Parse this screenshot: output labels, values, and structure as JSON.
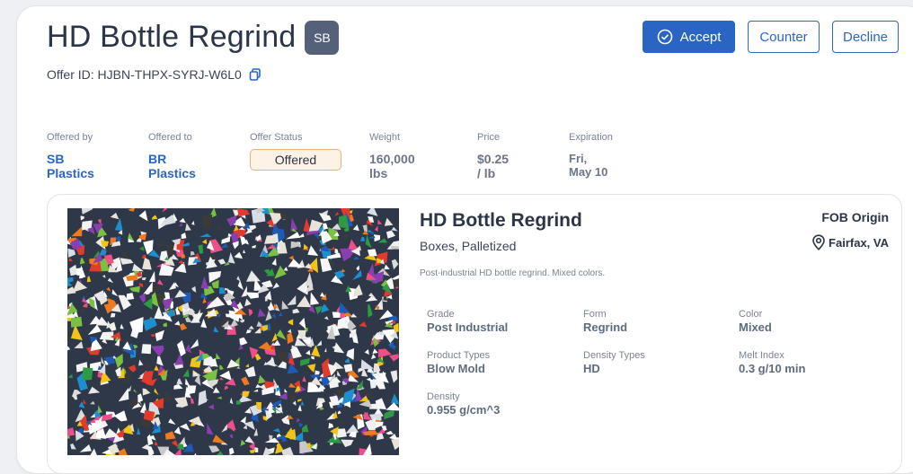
{
  "header": {
    "title": "HD Bottle Regrind",
    "badge": "SB",
    "offer_id_label": "Offer ID:",
    "offer_id": "HJBN-THPX-SYRJ-W6L0"
  },
  "actions": {
    "accept": "Accept",
    "counter": "Counter",
    "decline": "Decline"
  },
  "meta": [
    {
      "label": "Offered by",
      "value": "SB Plastics"
    },
    {
      "label": "Offered to",
      "value": "BR Plastics"
    },
    {
      "label": "Offer Status",
      "value": "Offered"
    },
    {
      "label": "Weight",
      "value": "160,000 lbs"
    },
    {
      "label": "Price",
      "value": "$0.25 / lb"
    },
    {
      "label": "Expiration",
      "value": "Fri, May 10"
    }
  ],
  "listing": {
    "title": "HD Bottle Regrind",
    "packaging": "Boxes, Palletized",
    "description": "Post-industrial HD bottle regrind. Mixed colors.",
    "fob": "FOB Origin",
    "location": "Fairfax, VA",
    "specs": [
      {
        "label": "Grade",
        "value": "Post Industrial"
      },
      {
        "label": "Form",
        "value": "Regrind"
      },
      {
        "label": "Color",
        "value": "Mixed"
      },
      {
        "label": "Product Types",
        "value": "Blow Mold"
      },
      {
        "label": "Density Types",
        "value": "HD"
      },
      {
        "label": "Melt Index",
        "value": "0.3 g/10 min"
      },
      {
        "label": "Density",
        "value": "0.955 g/cm^3"
      }
    ]
  },
  "colors": {
    "accent": "#2a65c4",
    "badge": "#556179",
    "status_bg": "#fdf2e6",
    "status_border": "#e7b27d"
  }
}
